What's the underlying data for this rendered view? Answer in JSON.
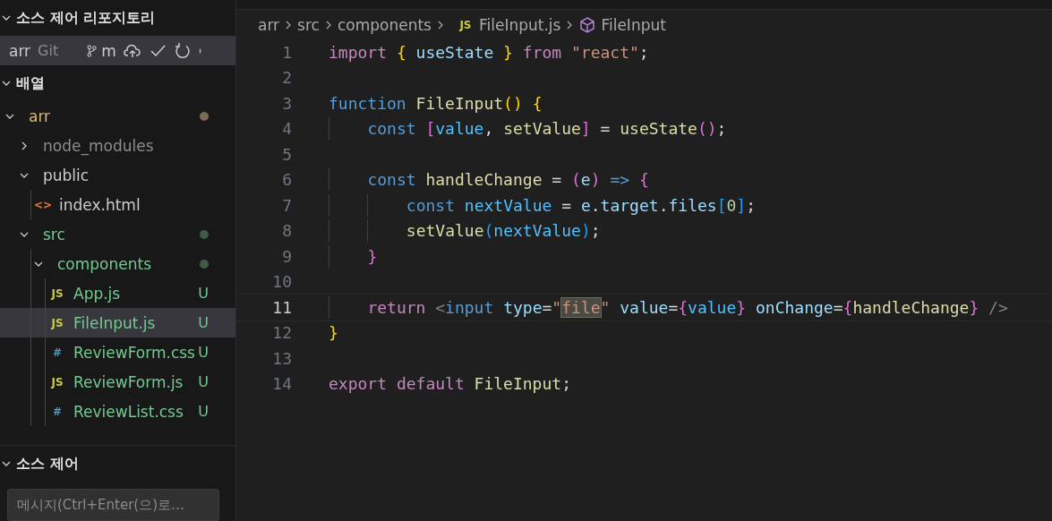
{
  "sidebar": {
    "repositories_header": "소스 제어 리포지토리",
    "repository": {
      "name": "arr",
      "provider": "Git",
      "branch": "m"
    },
    "section_title": "배열",
    "tree": [
      {
        "label": "arr",
        "kind": "folder",
        "expanded": true,
        "color": "#d7ba7d",
        "dot": {
          "color": "#7c6b55"
        },
        "children": [
          {
            "label": "node_modules",
            "kind": "folder",
            "expanded": false,
            "color": "#8c8c8c"
          },
          {
            "label": "public",
            "kind": "folder",
            "expanded": true,
            "color": "#cccccc",
            "children": [
              {
                "label": "index.html",
                "kind": "file",
                "icon": {
                  "text": "<>",
                  "color": "#e37933"
                },
                "color": "#cccccc",
                "selected": false
              }
            ]
          },
          {
            "label": "src",
            "kind": "folder",
            "expanded": true,
            "color": "#73c991",
            "dot": {
              "color": "#3d5c45"
            },
            "children": [
              {
                "label": "components",
                "kind": "folder",
                "expanded": true,
                "color": "#73c991",
                "dot": {
                  "color": "#3d5c45"
                },
                "children": [
                  {
                    "label": "App.js",
                    "kind": "file",
                    "icon": {
                      "text": "JS",
                      "color": "#cbcb41"
                    },
                    "color": "#73c991",
                    "badge": "U",
                    "selected": false
                  },
                  {
                    "label": "FileInput.js",
                    "kind": "file",
                    "icon": {
                      "text": "JS",
                      "color": "#cbcb41"
                    },
                    "color": "#73c991",
                    "badge": "U",
                    "selected": true
                  },
                  {
                    "label": "ReviewForm.css",
                    "kind": "file",
                    "icon": {
                      "text": "#",
                      "color": "#519aba"
                    },
                    "color": "#73c991",
                    "badge": "U",
                    "selected": false
                  },
                  {
                    "label": "ReviewForm.js",
                    "kind": "file",
                    "icon": {
                      "text": "JS",
                      "color": "#cbcb41"
                    },
                    "color": "#73c991",
                    "badge": "U",
                    "selected": false
                  },
                  {
                    "label": "ReviewList.css",
                    "kind": "file",
                    "icon": {
                      "text": "#",
                      "color": "#519aba"
                    },
                    "color": "#73c991",
                    "badge": "U",
                    "selected": false
                  }
                ]
              }
            ]
          }
        ]
      }
    ],
    "source_control_title": "소스 제어",
    "message": {
      "placeholder": "메시지(Ctrl+Enter(으)로…"
    }
  },
  "breadcrumb": [
    {
      "label": "arr",
      "kind": "folder"
    },
    {
      "label": "src",
      "kind": "folder"
    },
    {
      "label": "components",
      "kind": "folder"
    },
    {
      "label": "FileInput.js",
      "kind": "file",
      "icon": {
        "text": "JS",
        "color": "#cbcb41"
      }
    },
    {
      "label": "FileInput",
      "kind": "symbol"
    }
  ],
  "editor": {
    "lines": [
      {
        "number": "1",
        "current": false,
        "tokens": [
          {
            "t": "import",
            "kind": "kw"
          },
          {
            "t": "{",
            "kind": "b1",
            "sp": true
          },
          {
            "t": "useState",
            "kind": "var",
            "sp": true
          },
          {
            "t": "}",
            "kind": "b1",
            "sp": true
          },
          {
            "t": "from",
            "kind": "kw",
            "sp": true
          },
          {
            "t": "\"react\"",
            "kind": "str",
            "sp": true
          },
          {
            "t": ";",
            "kind": "p"
          }
        ]
      },
      {
        "number": "2",
        "current": false
      },
      {
        "number": "3",
        "current": false,
        "tokens": [
          {
            "t": "function",
            "kind": "st"
          },
          {
            "t": "FileInput",
            "kind": "fn",
            "sp": true
          },
          {
            "t": "()",
            "kind": "b1"
          },
          {
            "t": "{",
            "kind": "b1",
            "sp": true
          }
        ]
      },
      {
        "number": "4",
        "current": false,
        "tokens": [
          {
            "t": "const",
            "kind": "st"
          },
          {
            "t": "[",
            "kind": "b2",
            "sp": true
          },
          {
            "t": "value",
            "kind": "cv"
          },
          {
            "t": ",",
            "kind": "p"
          },
          {
            "t": "setValue",
            "kind": "fn",
            "sp": true
          },
          {
            "t": "]",
            "kind": "b2"
          },
          {
            "t": "=",
            "kind": "p",
            "sp": true
          },
          {
            "t": "useState",
            "kind": "fn",
            "sp": true
          },
          {
            "t": "()",
            "kind": "b2"
          },
          {
            "t": ";",
            "kind": "p"
          }
        ]
      },
      {
        "number": "5",
        "current": false
      },
      {
        "number": "6",
        "current": false,
        "tokens": [
          {
            "t": "const",
            "kind": "st"
          },
          {
            "t": "handleChange",
            "kind": "fn",
            "sp": true
          },
          {
            "t": "=",
            "kind": "p",
            "sp": true
          },
          {
            "t": "(",
            "kind": "b2",
            "sp": true
          },
          {
            "t": "e",
            "kind": "var"
          },
          {
            "t": ")",
            "kind": "b2"
          },
          {
            "t": "=>",
            "kind": "st",
            "sp": true
          },
          {
            "t": "{",
            "kind": "b2",
            "sp": true
          }
        ]
      },
      {
        "number": "7",
        "current": false,
        "tokens": [
          {
            "t": "const",
            "kind": "st"
          },
          {
            "t": "nextValue",
            "kind": "cv",
            "sp": true
          },
          {
            "t": "=",
            "kind": "p",
            "sp": true
          },
          {
            "t": "e",
            "kind": "var",
            "sp": true
          },
          {
            "t": ".",
            "kind": "p"
          },
          {
            "t": "target",
            "kind": "var"
          },
          {
            "t": ".",
            "kind": "p"
          },
          {
            "t": "files",
            "kind": "var"
          },
          {
            "t": "[",
            "kind": "b3"
          },
          {
            "t": "0",
            "kind": "num"
          },
          {
            "t": "]",
            "kind": "b3"
          },
          {
            "t": ";",
            "kind": "p"
          }
        ]
      },
      {
        "number": "8",
        "current": false,
        "tokens": [
          {
            "t": "setValue",
            "kind": "fn"
          },
          {
            "t": "(",
            "kind": "b3"
          },
          {
            "t": "nextValue",
            "kind": "cv"
          },
          {
            "t": ")",
            "kind": "b3"
          },
          {
            "t": ";",
            "kind": "p"
          }
        ]
      },
      {
        "number": "9",
        "current": false,
        "tokens": [
          {
            "t": "}",
            "kind": "b2"
          }
        ]
      },
      {
        "number": "10",
        "current": false
      },
      {
        "number": "11",
        "current": true,
        "tokens": [
          {
            "t": "return",
            "kind": "kw"
          },
          {
            "t": "<",
            "kind": "tag",
            "sp": true
          },
          {
            "t": "input",
            "kind": "st"
          },
          {
            "t": "type",
            "kind": "var",
            "sp": true
          },
          {
            "t": "=",
            "kind": "p"
          },
          {
            "t": "\"",
            "kind": "str"
          },
          {
            "t": "file",
            "kind": "hl"
          },
          {
            "t": "\"",
            "kind": "str"
          },
          {
            "t": "value",
            "kind": "var",
            "sp": true
          },
          {
            "t": "=",
            "kind": "p"
          },
          {
            "t": "{",
            "kind": "b2"
          },
          {
            "t": "value",
            "kind": "cv"
          },
          {
            "t": "}",
            "kind": "b2"
          },
          {
            "t": "onChange",
            "kind": "var",
            "sp": true
          },
          {
            "t": "=",
            "kind": "p"
          },
          {
            "t": "{",
            "kind": "b2"
          },
          {
            "t": "handleChange",
            "kind": "fn"
          },
          {
            "t": "}",
            "kind": "b2"
          },
          {
            "t": "/>",
            "kind": "tag",
            "sp": true
          }
        ]
      },
      {
        "number": "12",
        "current": false,
        "tokens": [
          {
            "t": "}",
            "kind": "b1"
          }
        ]
      },
      {
        "number": "13",
        "current": false
      },
      {
        "number": "14",
        "current": false,
        "tokens": [
          {
            "t": "export",
            "kind": "kw"
          },
          {
            "t": "default",
            "kind": "kw",
            "sp": true
          },
          {
            "t": "FileInput",
            "kind": "fn",
            "sp": true
          },
          {
            "t": ";",
            "kind": "p"
          }
        ]
      }
    ]
  }
}
